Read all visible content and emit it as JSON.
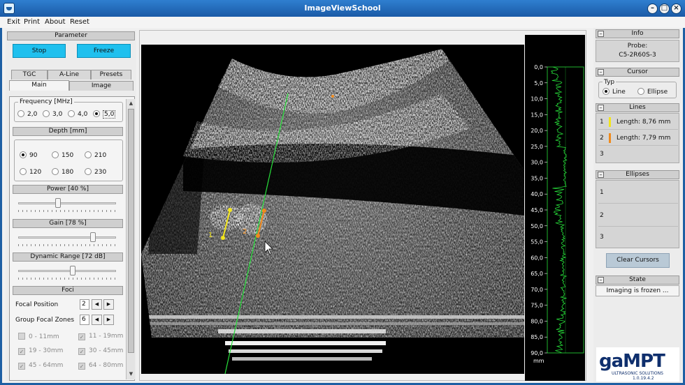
{
  "window": {
    "title": "ImageViewSchool"
  },
  "menu": [
    "Exit",
    "Print",
    "About",
    "Reset"
  ],
  "left": {
    "parameter_header": "Parameter",
    "stop_label": "Stop",
    "freeze_label": "Freeze",
    "tabs_top": [
      "TGC",
      "A-Line",
      "Presets"
    ],
    "tabs_bottom": [
      "Main",
      "Image"
    ],
    "active_tab": "Main",
    "frequency": {
      "label": "Frequency [MHz]",
      "options": [
        "2,0",
        "3,0",
        "4,0",
        "5,0"
      ],
      "selected": "5,0"
    },
    "depth": {
      "label": "Depth [mm]",
      "options": [
        "90",
        "150",
        "210",
        "120",
        "180",
        "230"
      ],
      "selected": "90"
    },
    "power": {
      "label": "Power  [40 %]",
      "level": 0.4
    },
    "gain": {
      "label": "Gain  [78 %]",
      "level": 0.78
    },
    "dynamic_range": {
      "label": "Dynamic Range  [72 dB]",
      "level": 0.56
    },
    "foci": {
      "label": "Foci",
      "focal_position_label": "Focal Position",
      "focal_position_value": "2",
      "group_zones_label": "Group Focal Zones",
      "group_zones_value": "6",
      "zones": [
        {
          "label": "0 - 11mm",
          "checked": false
        },
        {
          "label": "11 - 19mm",
          "checked": true
        },
        {
          "label": "19 - 30mm",
          "checked": true
        },
        {
          "label": "30 - 45mm",
          "checked": true
        },
        {
          "label": "45 - 64mm",
          "checked": true
        },
        {
          "label": "64 - 80mm",
          "checked": true
        }
      ]
    }
  },
  "ultrasound": {
    "line_labels": [
      "1",
      "2"
    ],
    "line_colors": [
      "#f2e51b",
      "#f08a1c"
    ]
  },
  "amode": {
    "ticks": [
      "0,0",
      "5,0",
      "10,0",
      "15,0",
      "20,0",
      "25,0",
      "30,0",
      "35,0",
      "40,0",
      "45,0",
      "50,0",
      "55,0",
      "60,0",
      "65,0",
      "70,0",
      "75,0",
      "80,0",
      "85,0",
      "90,0"
    ],
    "unit": "mm",
    "trace_color": "#27e03a"
  },
  "right": {
    "info_header": "Info",
    "probe_label": "Probe:",
    "probe_value": "C5-2R60S-3",
    "cursor_header": "Cursor",
    "typ_label": "Typ",
    "typ_options": [
      "Line",
      "Ellipse"
    ],
    "typ_selected": "Line",
    "lines_header": "Lines",
    "lines": [
      {
        "n": "1",
        "text": "Length: 8,76 mm",
        "color": "#f2e51b"
      },
      {
        "n": "2",
        "text": "Length: 7,79 mm",
        "color": "#f08a1c"
      },
      {
        "n": "3",
        "text": "",
        "color": ""
      }
    ],
    "ellipses_header": "Ellipses",
    "ellipses": [
      "1",
      "2",
      "3"
    ],
    "clear_label": "Clear Cursors",
    "state_header": "State",
    "state_value": "Imaging is frozen ...",
    "logo": {
      "brand": "gaMPT",
      "tagline": "ULTRASONIC  SOLUTIONS",
      "version": "1.0.19.4.2"
    }
  }
}
